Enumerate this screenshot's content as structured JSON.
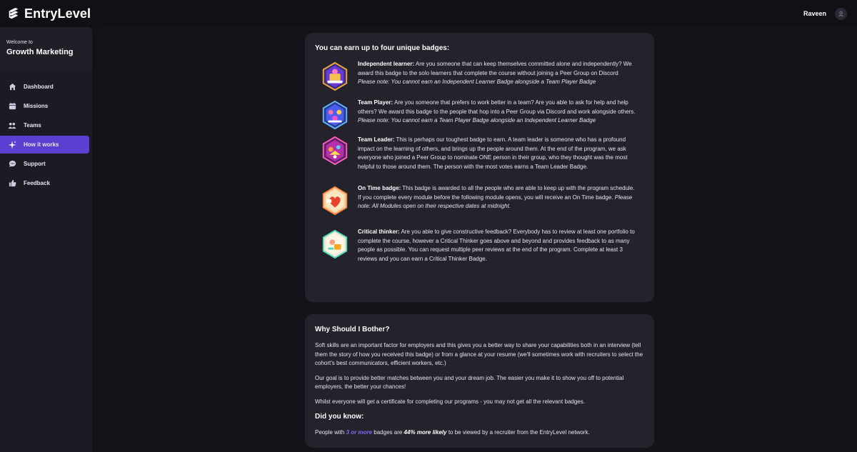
{
  "brand": {
    "name": "EntryLevel"
  },
  "user": {
    "name": "Raveen"
  },
  "sidebar": {
    "welcome": "Welcome to",
    "course": "Growth Marketing",
    "items": [
      {
        "label": "Dashboard",
        "icon": "home-icon"
      },
      {
        "label": "Missions",
        "icon": "calendar-icon"
      },
      {
        "label": "Teams",
        "icon": "teams-icon"
      },
      {
        "label": "How it works",
        "icon": "sparkle-icon",
        "active": true
      },
      {
        "label": "Support",
        "icon": "chat-icon"
      },
      {
        "label": "Feedback",
        "icon": "thumbs-up-icon"
      }
    ]
  },
  "badges_card": {
    "title": "You can earn up to four unique badges:",
    "badges": [
      {
        "name": "Independent learner:",
        "desc": " Are you someone that can keep themselves committed alone and independently? We award this badge to the solo learners that complete the course without joining a Peer Group on Discord ",
        "note": "Please note: You cannot earn an Independent Learner Badge alongside a Team Player Badge"
      },
      {
        "name": "Team Player:",
        "desc": " Are you someone that prefers to work better in a team? Are you able to ask for help and help others? We award this badge to the people that hop into a Peer Group via Discord and work alongside others. ",
        "note": "Please note: You cannot earn a Team Player Badge alongside an Independent Learner Badge"
      },
      {
        "name": "Team Leader:",
        "desc": " This is perhaps our toughest badge to earn. A team leader is someone who has a profound impact on the learning of others, and brings up the people around them. At the end of the program, we ask everyone who joined a Peer Group to nominate ONE person in their group, who they thought was the most helpful to those around them. The person with the most votes earns a Team Leader Badge.",
        "note": ""
      },
      {
        "name": "On Time badge:",
        "desc": " This badge is awarded to all the people who are able to keep up with the program schedule. If you complete every module before the following module opens, you will receive an On Time badge. ",
        "note": "Please note: All Modules open on their respective dates at midnight."
      },
      {
        "name": "Critical thinker:",
        "desc": " Are you able to give constructive feedback? Everybody has to review at least one portfolio to complete the course, however a Critical Thinker goes above and beyond and provides feedback to as many people as possible. You can request multiple peer reviews at the end of the program. Complete at least 3 reviews and you can earn a Critical Thinker Badge.",
        "note": ""
      }
    ]
  },
  "why_card": {
    "title": "Why Should I Bother?",
    "p1": "Soft skills are an important factor for employers and this gives you a better way to share your capabilities both in an interview (tell them the story of how you received this badge) or from a glance at your resume (we'll sometimes work with recruiters to select the cohort's best communicators, efficient workers, etc.)",
    "p2": "Our goal is to provide better matches between you and your dream job. The easier you make it to show you off to potential employers, the better your chances!",
    "p3": "Whilst everyone will get a certificate for completing our programs - you may not get all the relevant badges.",
    "did_you_know": "Did you know:",
    "fact_pre": "People with ",
    "fact_accent": "3 or more",
    "fact_mid": " badges are ",
    "fact_bold": "44% more likely",
    "fact_post": " to be viewed by a recruiter from the EntryLevel network."
  },
  "colors": {
    "accent": "#5a3fd0",
    "accent_text": "#7f6cf0",
    "card": "#24222b",
    "background": "#15131a"
  }
}
